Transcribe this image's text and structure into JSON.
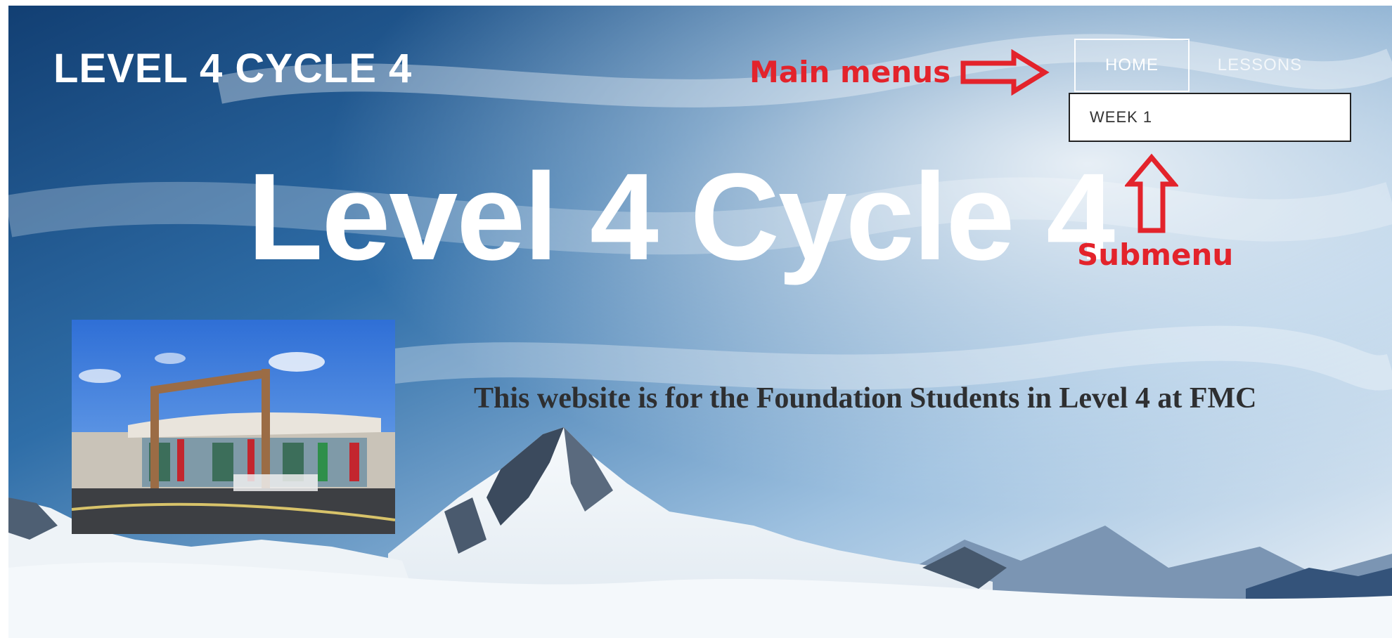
{
  "site": {
    "title": "LEVEL 4 CYCLE 4"
  },
  "nav": {
    "items": [
      {
        "label": "HOME",
        "active": true
      },
      {
        "label": "LESSONS",
        "active": false
      }
    ],
    "submenu": {
      "items": [
        {
          "label": "WEEK 1"
        }
      ]
    }
  },
  "annotations": {
    "main_menus": "Main menus",
    "submenu": "Submenu",
    "color": "#e3232b"
  },
  "hero": {
    "heading": "Level 4 Cycle 4",
    "tagline": "This website is for the Foundation Students in Level 4 at FMC",
    "background": "snowy mountain under blue cloudy sky",
    "image": "college building with flags"
  }
}
